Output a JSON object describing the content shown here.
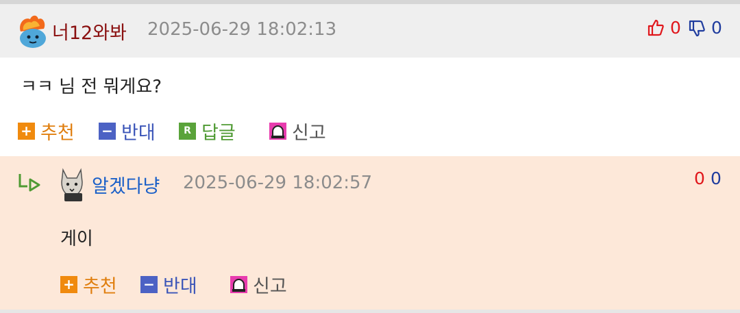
{
  "comment": {
    "author": "너12와봐",
    "author_color": "#8a1010",
    "date": "2025-06-29 18:02:13",
    "upvotes": "0",
    "downvotes": "0",
    "text": "ㅋㅋ 님 전 뭐게요?",
    "actions": {
      "recommend": "추천",
      "oppose": "반대",
      "reply": "답글",
      "report": "신고"
    }
  },
  "reply": {
    "author": "알겠다냥",
    "author_color": "#1a5fc8",
    "date": "2025-06-29 18:02:57",
    "upvotes": "0",
    "downvotes": "0",
    "text": "게이",
    "actions": {
      "recommend": "추천",
      "oppose": "반대",
      "report": "신고"
    }
  },
  "colors": {
    "header_bg": "#efefef",
    "reply_bg": "#fde8d9",
    "recommend": "#f08a0e",
    "oppose": "#4c62c4",
    "reply_btn": "#5aa33a",
    "report": "#e83cae"
  }
}
